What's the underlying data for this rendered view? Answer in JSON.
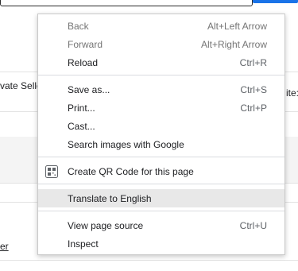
{
  "page": {
    "left_fragment_1": "vate Selle",
    "right_fragment_1": "ite:",
    "link_fragment": "er"
  },
  "menu": {
    "items": [
      {
        "label": "Back",
        "shortcut": "Alt+Left Arrow"
      },
      {
        "label": "Forward",
        "shortcut": "Alt+Right Arrow"
      },
      {
        "label": "Reload",
        "shortcut": "Ctrl+R"
      },
      {
        "label": "Save as...",
        "shortcut": "Ctrl+S"
      },
      {
        "label": "Print...",
        "shortcut": "Ctrl+P"
      },
      {
        "label": "Cast...",
        "shortcut": ""
      },
      {
        "label": "Search images with Google",
        "shortcut": ""
      },
      {
        "label": "Create QR Code for this page",
        "shortcut": "",
        "icon": "qr-code-icon"
      },
      {
        "label": "Translate to English",
        "shortcut": "",
        "hovered": true
      },
      {
        "label": "View page source",
        "shortcut": "Ctrl+U"
      },
      {
        "label": "Inspect",
        "shortcut": ""
      }
    ]
  },
  "colors": {
    "hover": "#e8e8e8",
    "accent_blue": "#1a73e8",
    "disabled_text": "#757575"
  }
}
